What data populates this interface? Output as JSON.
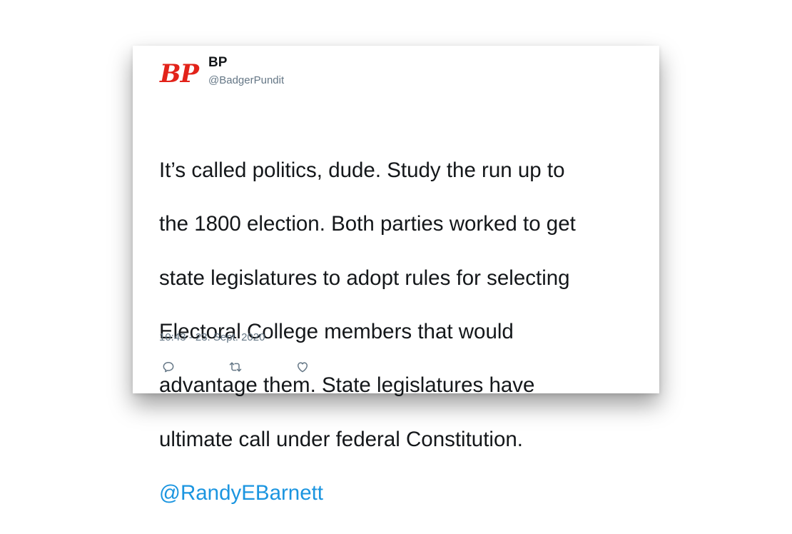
{
  "tweet": {
    "display_name": "BP",
    "handle": "@BadgerPundit",
    "avatar_text": "BP",
    "text_lines": [
      "It’s called politics, dude. Study the run up to",
      "the 1800 election. Both parties worked to get",
      "state legislatures to adopt rules for selecting",
      "Electoral College members that would",
      "advantage them. State legislatures have",
      "ultimate call under federal Constitution."
    ],
    "mention": "@RandyEBarnett",
    "timestamp": "10:43 - 23. Sept. 2020"
  },
  "actions": {
    "reply_icon": "reply-icon",
    "retweet_icon": "retweet-icon",
    "like_icon": "heart-icon"
  },
  "colors": {
    "avatar_red": "#e2231a",
    "text": "#14171a",
    "secondary": "#657786",
    "link": "#1b95e0"
  }
}
